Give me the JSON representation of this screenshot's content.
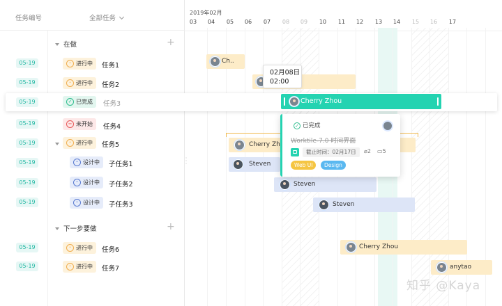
{
  "header": {
    "col_number": "任务编号",
    "col_all_tasks": "全部任务",
    "month": "2019年02月",
    "days": [
      "03",
      "04",
      "05",
      "06",
      "07",
      "08",
      "09",
      "10",
      "11",
      "12",
      "13",
      "14",
      "15",
      "16",
      "17"
    ]
  },
  "groups": [
    {
      "label": "在做"
    },
    {
      "label": "下一步要做"
    }
  ],
  "tasks": [
    {
      "tag": "05-19",
      "status": "进行中",
      "name": "任务1"
    },
    {
      "tag": "05-19",
      "status": "进行中",
      "name": "任务2"
    },
    {
      "tag": "05-19",
      "status": "已完成",
      "name": "任务3"
    },
    {
      "tag": "05-19",
      "status": "未开始",
      "name": "任务4"
    },
    {
      "tag": "05-19",
      "status": "进行中",
      "name": "任务5"
    },
    {
      "tag": "05-19",
      "status": "设计中",
      "name": "子任务1"
    },
    {
      "tag": "05-19",
      "status": "设计中",
      "name": "子任务2"
    },
    {
      "tag": "05-19",
      "status": "设计中",
      "name": "子任务3"
    },
    {
      "tag": "05-19",
      "status": "进行中",
      "name": "任务6"
    },
    {
      "tag": "05-19",
      "status": "进行中",
      "name": "任务7"
    }
  ],
  "bars": [
    {
      "assignee": "Ch..",
      "color": "orange"
    },
    {
      "assignee": "",
      "color": "orange"
    },
    {
      "assignee": "Cherry Zhou",
      "color": "green"
    },
    {
      "assignee": "Cherry Zhou",
      "color": "orange"
    },
    {
      "assignee": "Steven",
      "color": "blue"
    },
    {
      "assignee": "Steven",
      "color": "blue"
    },
    {
      "assignee": "Steven",
      "color": "blue"
    },
    {
      "assignee": "Cherry Zhou",
      "color": "orange"
    },
    {
      "assignee": "anytao",
      "color": "orange"
    }
  ],
  "tooltip": {
    "date": "02月08日",
    "time": "02:00"
  },
  "card": {
    "status": "已完成",
    "title": "Worktile-7.0 时间界面",
    "deadline": "截止时间：02月17日",
    "attachments": "2",
    "comments": "5",
    "tags": [
      "Web UI",
      "Design"
    ]
  },
  "colors": {
    "accent": "#24d3b1",
    "in_progress": "#f0ad4e",
    "done": "#2ebd8e",
    "not_started": "#e85757",
    "design": "#5a7bd1",
    "tag_webui": "#f5c542",
    "tag_design": "#5ab8f0"
  },
  "watermark": "知乎 @Kaya"
}
